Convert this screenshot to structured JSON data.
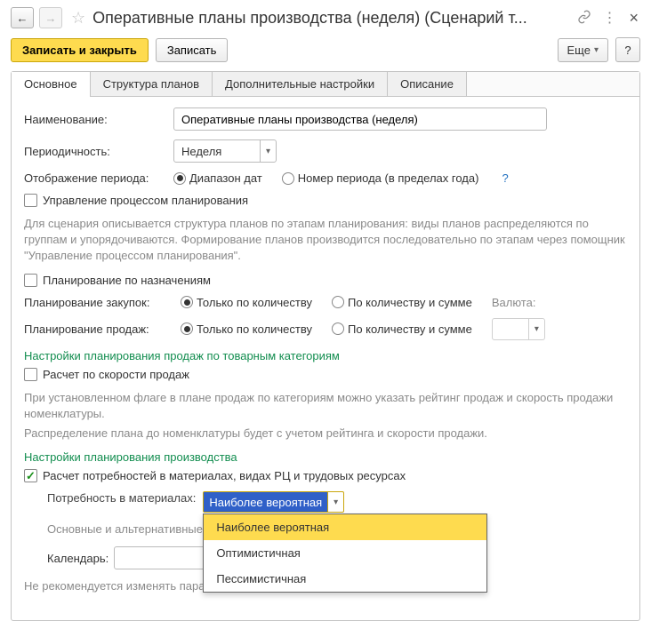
{
  "title": "Оперативные планы производства (неделя) (Сценарий т...",
  "toolbar": {
    "save_close": "Записать и закрыть",
    "save": "Записать",
    "more": "Еще",
    "help": "?"
  },
  "tabs": {
    "main": "Основное",
    "structure": "Структура планов",
    "extra": "Дополнительные настройки",
    "desc": "Описание"
  },
  "labels": {
    "name": "Наименование:",
    "periodicity": "Периодичность:",
    "display": "Отображение периода:",
    "plan_zakup": "Планирование закупок:",
    "plan_prod": "Планирование продаж:",
    "currency": "Валюта:",
    "material_need": "Потребность в материалах:",
    "calendar": "Календарь:"
  },
  "fields": {
    "name_value": "Оперативные планы производства (неделя)",
    "periodicity_value": "Неделя",
    "material_need_value": "Наиболее вероятная"
  },
  "radios": {
    "range": "Диапазон дат",
    "period_num": "Номер периода (в пределах года)",
    "only_qty": "Только по количеству",
    "qty_sum": "По количеству и сумме"
  },
  "checkboxes": {
    "process_mgmt": "Управление процессом планирования",
    "by_assignment": "Планирование по назначениям",
    "speed_calc": "Расчет по скорости продаж",
    "resource_calc": "Расчет потребностей в материалах, видах РЦ и трудовых ресурсах"
  },
  "descriptions": {
    "process": "Для сценария описывается структура планов по этапам планирования: виды планов распределяются по группам и упорядочиваются. Формирование планов производится последовательно по этапам через помощник \"Управление процессом планирования\".",
    "speed1": "При установленном флаге в плане продаж по категориям можно указать рейтинг продаж и скорость продажи номенклатуры.",
    "speed2": "Распределение плана до номенклатуры будет с учетом рейтинга и скорости продажи.",
    "materials": "Основные и альтернативные поправкой на вероятность пр",
    "bottom": "Не рекомендуется изменять парам планирования."
  },
  "headers": {
    "sales_cat": "Настройки планирования продаж по товарным категориям",
    "production": "Настройки планирования производства"
  },
  "dropdown": {
    "opt1": "Наиболее вероятная",
    "opt2": "Оптимистичная",
    "opt3": "Пессимистичная"
  },
  "help_q": "?"
}
